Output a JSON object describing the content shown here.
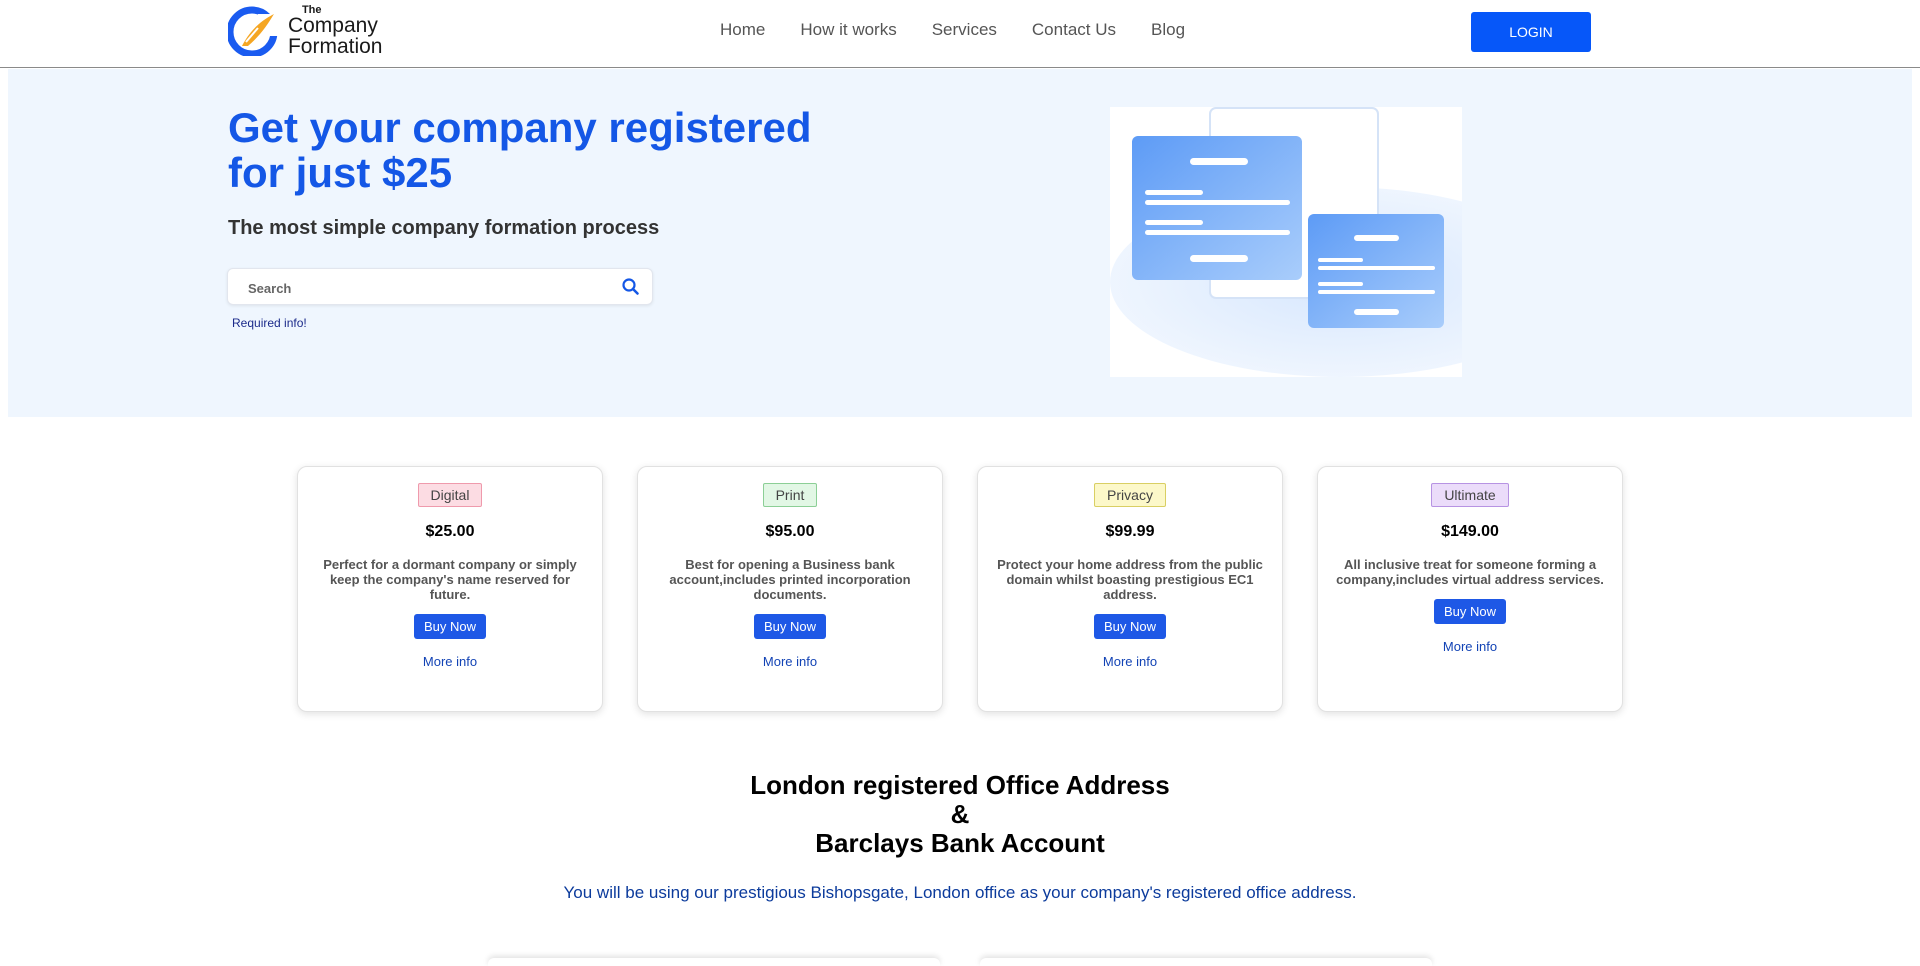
{
  "header": {
    "logo_the": "The",
    "logo_name": "Company Formation",
    "nav": [
      "Home",
      "How it works",
      "Services",
      "Contact Us",
      "Blog"
    ],
    "login_label": "LOGIN"
  },
  "hero": {
    "title": "Get your company registered for just $25",
    "subtitle": "The most simple company formation process",
    "search_placeholder": "Search",
    "required_text": "Required info!"
  },
  "packages": [
    {
      "tag": "Digital",
      "price": "$25.00",
      "description": "Perfect for a dormant company or simply keep the company's name reserved for future.",
      "buy_label": "Buy Now",
      "more_label": "More info",
      "tag_bg": "#fcdce3",
      "tag_border": "#ef9aac"
    },
    {
      "tag": "Print",
      "price": "$95.00",
      "description": "Best for opening a Business bank account,includes printed incorporation documents.",
      "buy_label": "Buy Now",
      "more_label": "More info",
      "tag_bg": "#e2f7e5",
      "tag_border": "#8ccf96"
    },
    {
      "tag": "Privacy",
      "price": "$99.99",
      "description": "Protect your home address from the public domain whilst boasting prestigious EC1 address.",
      "buy_label": "Buy Now",
      "more_label": "More info",
      "tag_bg": "#fcf8c9",
      "tag_border": "#d9cf63"
    },
    {
      "tag": "Ultimate",
      "price": "$149.00",
      "description": "All inclusive treat for someone forming a company,includes virtual address services.",
      "buy_label": "Buy Now",
      "more_label": "More info",
      "tag_bg": "#ebdcfa",
      "tag_border": "#b793e3"
    }
  ],
  "section": {
    "title_line1": "London registered Office Address",
    "title_line2": "&",
    "title_line3": "Barclays Bank Account",
    "text": "You will be using our prestigious Bishopsgate, London office as your company's registered office address."
  },
  "colors": {
    "brand_blue": "#0657f9",
    "hero_bg": "#eff6fe",
    "title_blue": "#1457e6"
  },
  "icons": [
    "logo-icon",
    "search-icon"
  ]
}
